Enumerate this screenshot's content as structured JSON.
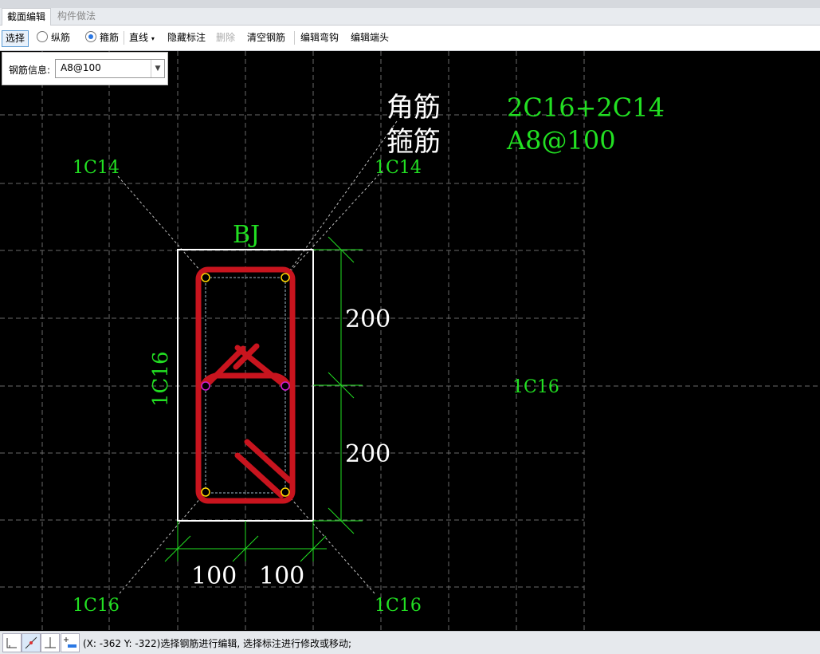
{
  "tabs": [
    {
      "label": "截面编辑",
      "active": true
    },
    {
      "label": "构件做法",
      "active": false
    }
  ],
  "toolbar": {
    "select_label": "选择",
    "longitudinal_label": "纵筋",
    "stirrup_label": "箍筋",
    "line_label": "直线",
    "hide_annotation_label": "隐藏标注",
    "delete_label": "删除",
    "clear_label": "清空钢筋",
    "edit_hook_label": "编辑弯钩",
    "edit_end_label": "编辑端头",
    "selected_radio": "stirrup"
  },
  "rebar_info": {
    "label": "钢筋信息:",
    "value": "A8@100"
  },
  "drawing": {
    "corner_label": "角筋",
    "corner_value": "2C16+2C14",
    "stirrup_label": "箍筋",
    "stirrup_value": "A8@100",
    "section_name": "BJ",
    "top_left_bar": "1C14",
    "top_right_bar": "1C14",
    "bottom_left_bar": "1C16",
    "bottom_right_bar": "1C16",
    "left_side_bar": "1C16",
    "right_side_bar": "1C16",
    "dim_upper": "200",
    "dim_lower": "200",
    "dim_left": "100",
    "dim_right": "100",
    "colors": {
      "annotation_green": "#22e022",
      "stirrup_red": "#c8141e",
      "section_white": "#ffffff",
      "grid": "#6a6a6a"
    }
  },
  "status": {
    "text": "(X: -362 Y: -322)选择钢筋进行编辑, 选择标注进行修改或移动;"
  }
}
